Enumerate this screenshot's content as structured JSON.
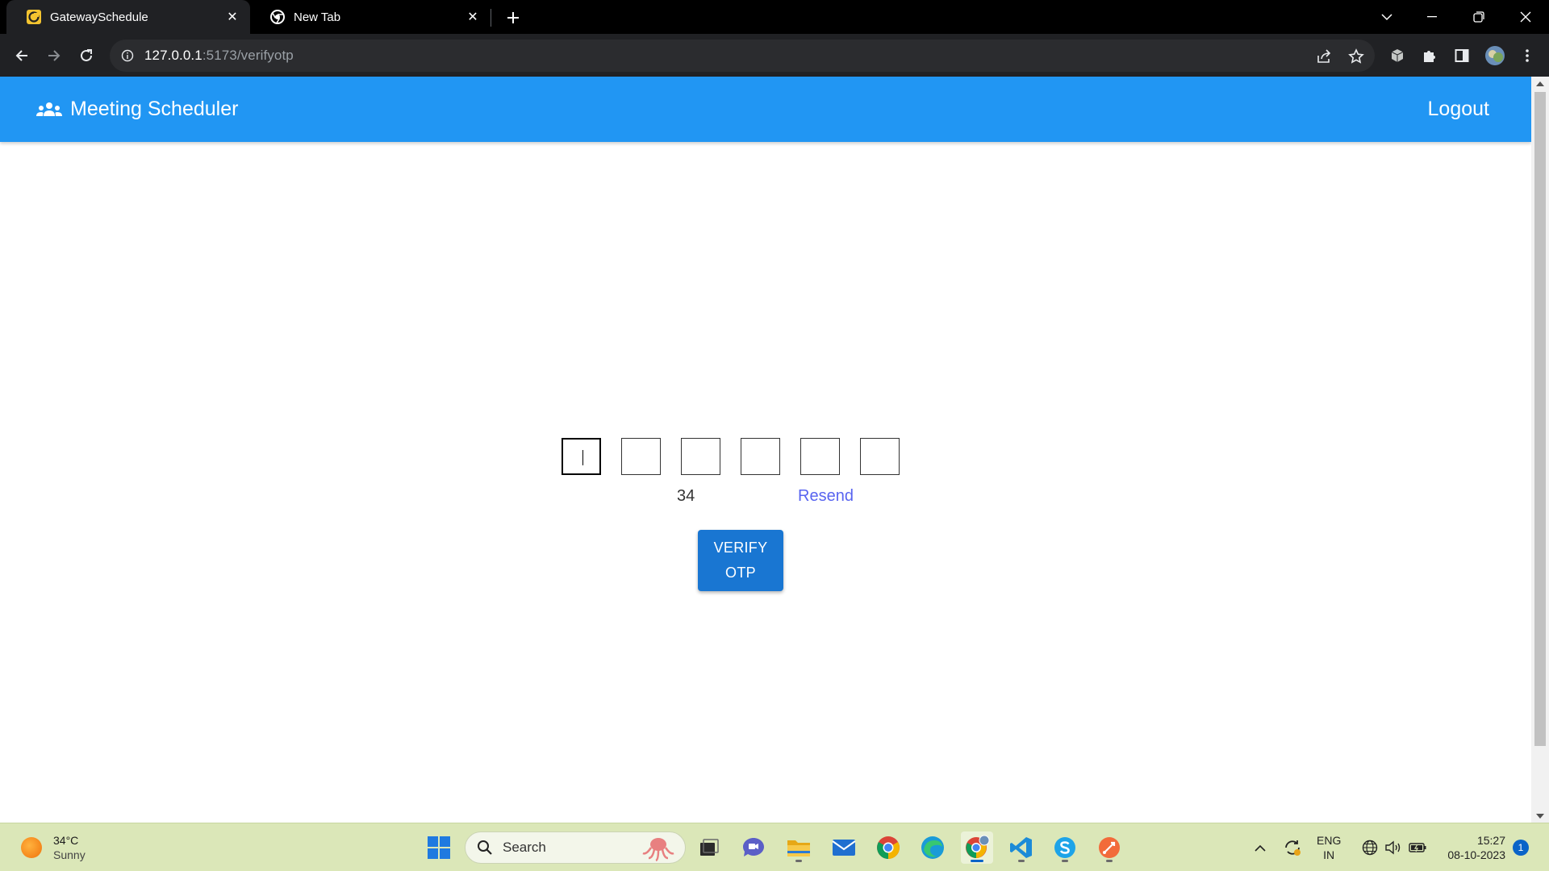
{
  "browser": {
    "tabs": [
      {
        "title": "GatewaySchedule",
        "active": true
      },
      {
        "title": "New Tab",
        "active": false
      }
    ],
    "url_host": "127.0.0.1",
    "url_rest": ":5173/verifyotp"
  },
  "app": {
    "title": "Meeting Scheduler",
    "logout_label": "Logout"
  },
  "otp": {
    "digits": [
      "",
      "",
      "",
      "",
      "",
      ""
    ],
    "focused_index": 0,
    "timer": "34",
    "resend_label": "Resend",
    "verify_line1": "VERIFY",
    "verify_line2": "OTP"
  },
  "taskbar": {
    "weather_temp": "34°C",
    "weather_cond": "Sunny",
    "search_label": "Search",
    "lang_line1": "ENG",
    "lang_line2": "IN",
    "time": "15:27",
    "date": "08-10-2023",
    "notification_count": "1",
    "apps": [
      "windows-start",
      "search",
      "task-view",
      "teams-chat",
      "file-explorer",
      "mail",
      "chrome",
      "edge",
      "chrome-profile",
      "vscode",
      "skype",
      "postman"
    ]
  },
  "colors": {
    "appbar": "#2196f3",
    "verify_button": "#1976d2",
    "resend_link": "#5864f0",
    "taskbar": "#dbe7b8"
  }
}
